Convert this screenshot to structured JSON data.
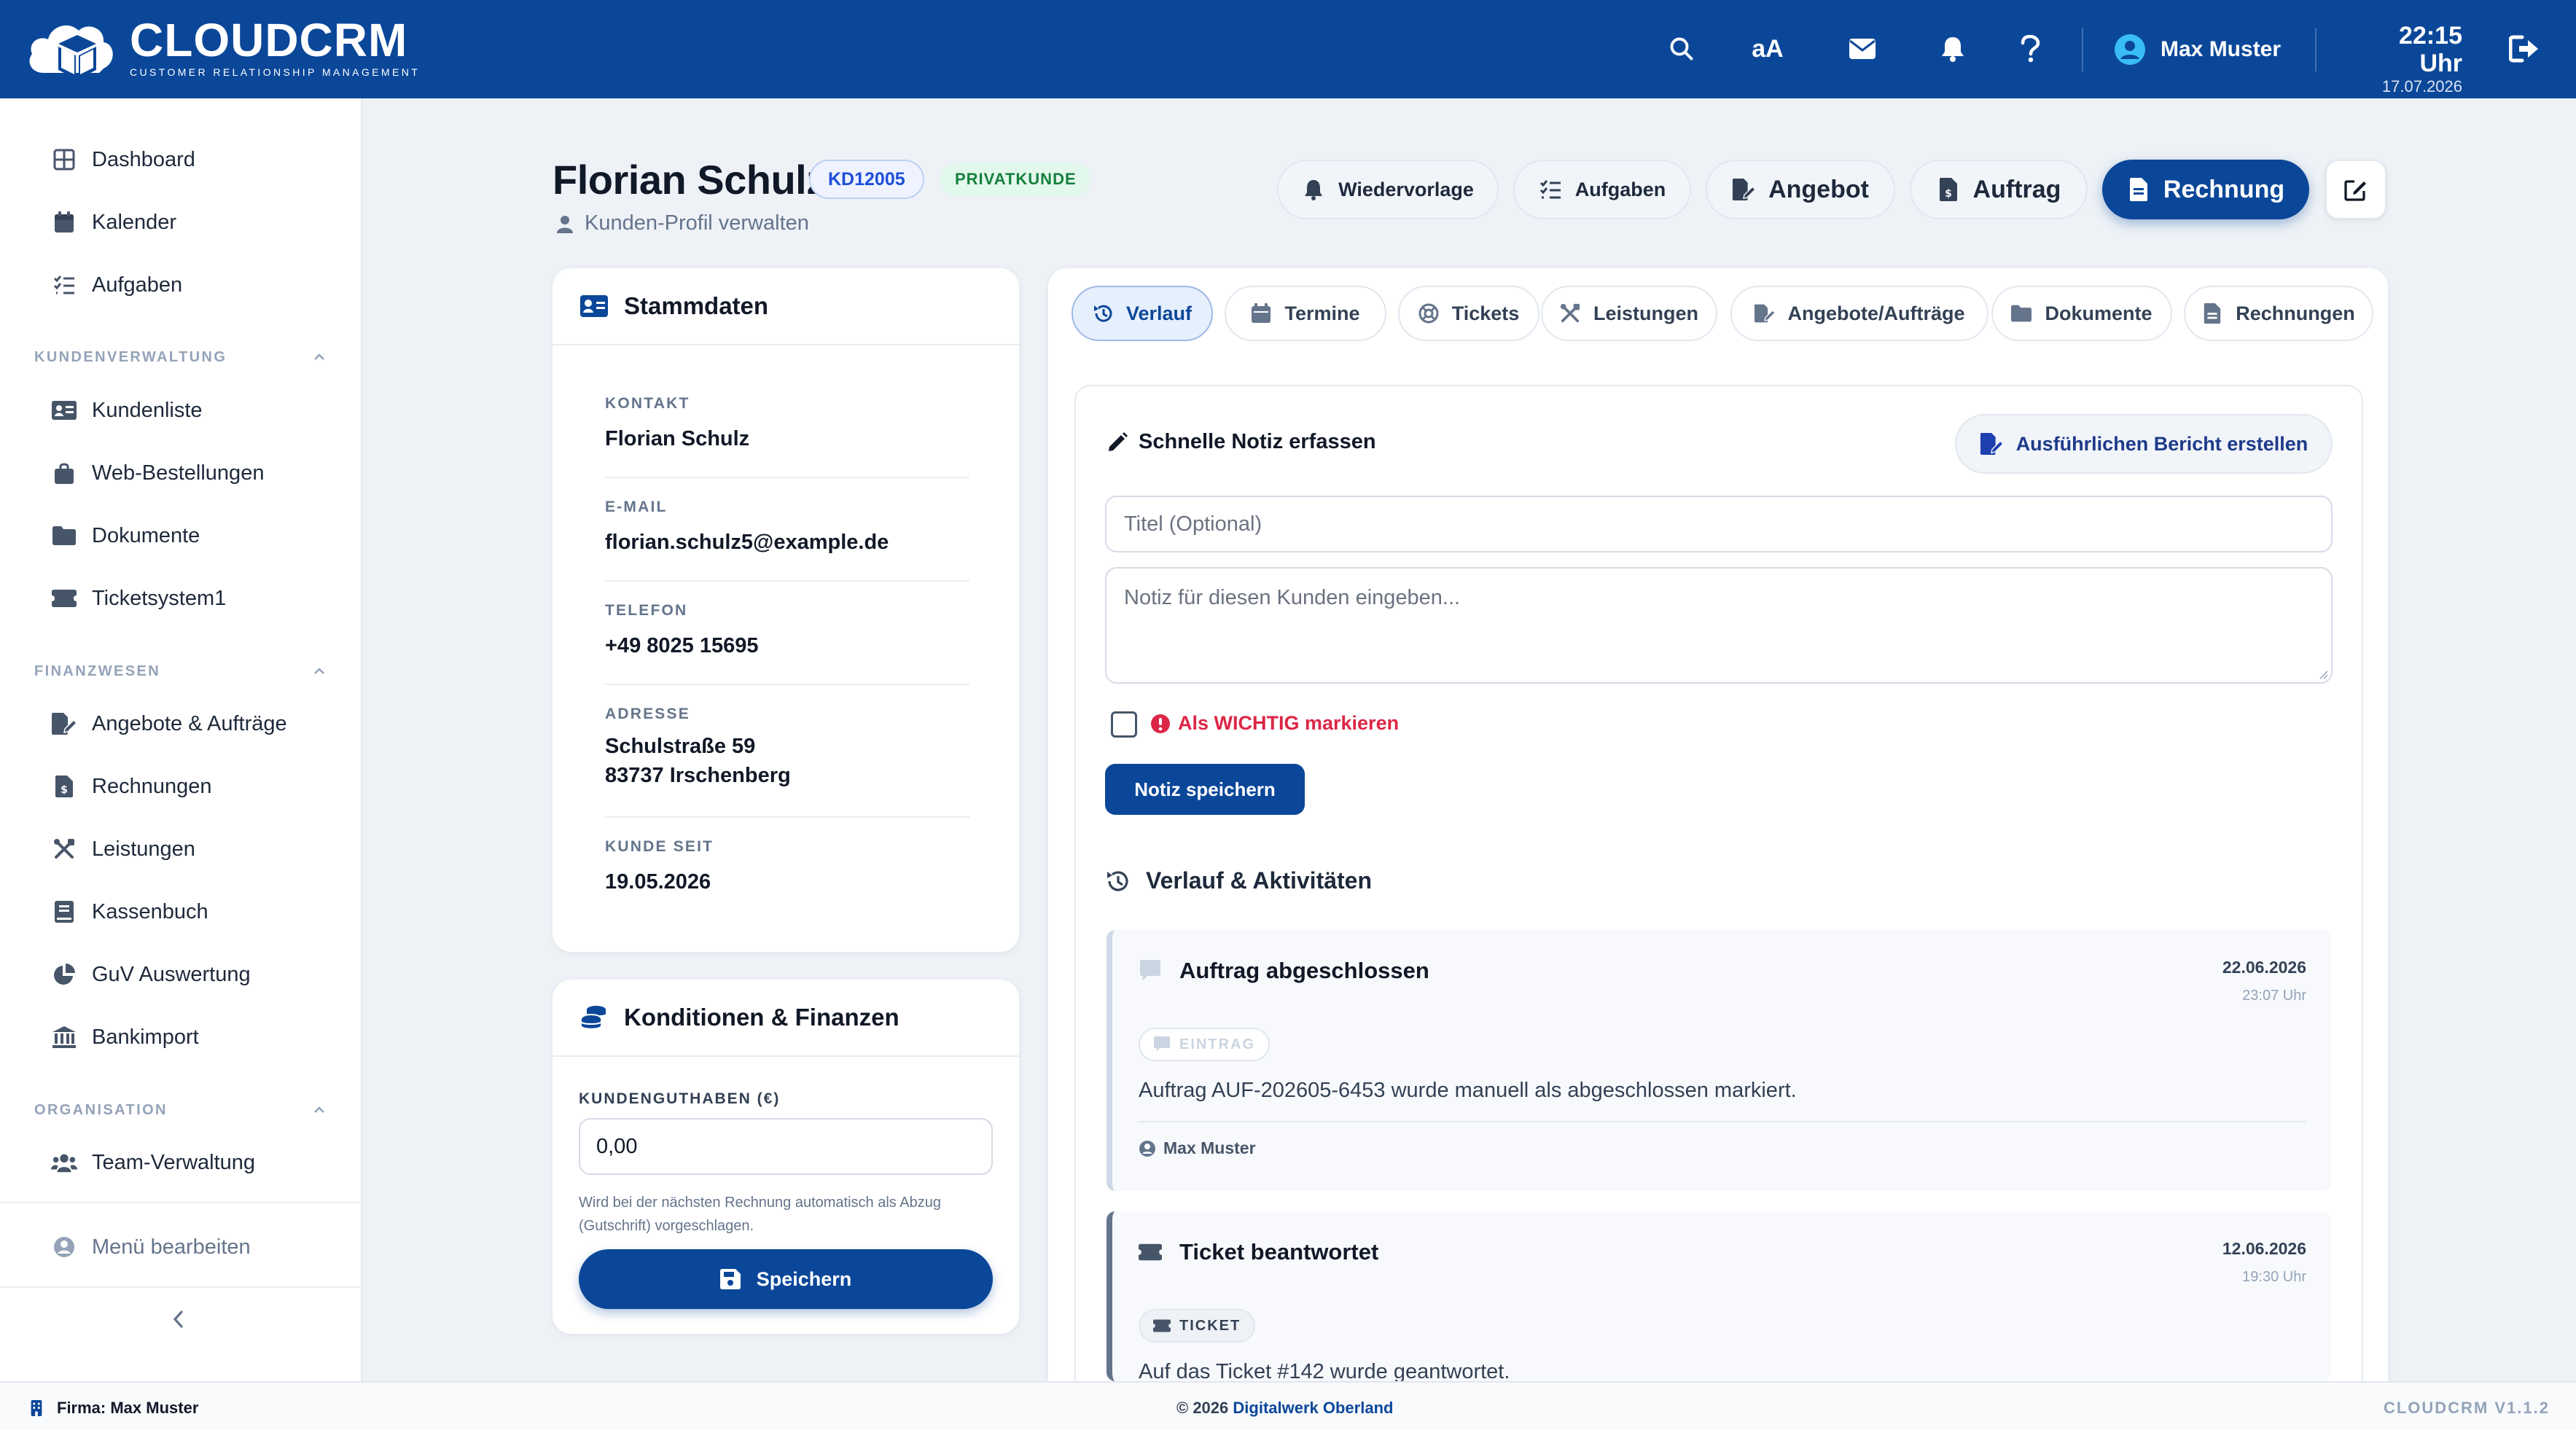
{
  "app": {
    "name": "CLOUDCRM",
    "tagline": "CUSTOMER RELATIONSHIP MANAGEMENT",
    "accent_color": "#0b4799"
  },
  "topbar": {
    "text_size_label": "aA",
    "user_name": "Max Muster",
    "time": "22:15 Uhr",
    "date": "17.07.2026"
  },
  "sidebar": {
    "items_top": [
      {
        "label": "Dashboard",
        "icon": "grid-icon"
      },
      {
        "label": "Kalender",
        "icon": "calendar-icon"
      },
      {
        "label": "Aufgaben",
        "icon": "tasks-icon"
      }
    ],
    "sections": [
      {
        "title": "KUNDENVERWALTUNG",
        "items": [
          {
            "label": "Kundenliste",
            "icon": "id-card-icon"
          },
          {
            "label": "Web-Bestellungen",
            "icon": "shopping-bag-icon"
          },
          {
            "label": "Dokumente",
            "icon": "folder-icon"
          },
          {
            "label": "Ticketsystem1",
            "icon": "ticket-icon"
          }
        ]
      },
      {
        "title": "FINANZWESEN",
        "items": [
          {
            "label": "Angebote & Aufträge",
            "icon": "file-signature-icon"
          },
          {
            "label": "Rechnungen",
            "icon": "invoice-icon"
          },
          {
            "label": "Leistungen",
            "icon": "tools-icon"
          },
          {
            "label": "Kassenbuch",
            "icon": "book-icon"
          },
          {
            "label": "GuV Auswertung",
            "icon": "pie-chart-icon"
          },
          {
            "label": "Bankimport",
            "icon": "bank-icon"
          }
        ]
      },
      {
        "title": "ORGANISATION",
        "items": [
          {
            "label": "Team-Verwaltung",
            "icon": "users-icon"
          }
        ]
      }
    ],
    "edit_menu": "Menü bearbeiten"
  },
  "customer": {
    "name": "Florian Schulz",
    "id": "KD12005",
    "type": "PRIVATKUNDE",
    "subtitle": "Kunden-Profil verwalten"
  },
  "header_buttons": {
    "wiedervorlage": "Wiedervorlage",
    "aufgaben": "Aufgaben",
    "angebot": "Angebot",
    "auftrag": "Auftrag",
    "rechnung": "Rechnung"
  },
  "stammdaten": {
    "title": "Stammdaten",
    "fields": [
      {
        "label": "KONTAKT",
        "value": "Florian Schulz"
      },
      {
        "label": "E-MAIL",
        "value": "florian.schulz5@example.de"
      },
      {
        "label": "TELEFON",
        "value": "+49 8025 15695"
      },
      {
        "label": "ADRESSE",
        "value": "Schulstraße 59",
        "value2": "83737 Irschenberg"
      },
      {
        "label": "KUNDE SEIT",
        "value": "19.05.2026"
      }
    ]
  },
  "finanzen": {
    "title": "Konditionen & Finanzen",
    "balance_label": "KUNDENGUTHABEN (€)",
    "balance_value": "0,00",
    "help_line1": "Wird bei der nächsten Rechnung automatisch als Abzug",
    "help_line2": "(Gutschrift) vorgeschlagen.",
    "save_label": "Speichern"
  },
  "tabs": [
    {
      "label": "Verlauf",
      "icon": "history-icon",
      "active": true
    },
    {
      "label": "Termine",
      "icon": "calendar-icon",
      "active": false
    },
    {
      "label": "Tickets",
      "icon": "lifebuoy-icon",
      "active": false
    },
    {
      "label": "Leistungen",
      "icon": "tools-icon",
      "active": false
    },
    {
      "label": "Angebote/Aufträge",
      "icon": "file-signature-icon",
      "active": false
    },
    {
      "label": "Dokumente",
      "icon": "folder-icon",
      "active": false
    },
    {
      "label": "Rechnungen",
      "icon": "invoice-icon",
      "active": false
    }
  ],
  "note": {
    "title": "Schnelle Notiz erfassen",
    "report_button": "Ausführlichen Bericht erstellen",
    "title_placeholder": "Titel (Optional)",
    "body_placeholder": "Notiz für diesen Kunden eingeben...",
    "important_label": "Als WICHTIG markieren",
    "important_checked": false,
    "save_label": "Notiz speichern"
  },
  "history": {
    "title": "Verlauf & Aktivitäten",
    "entries": [
      {
        "title": "Auftrag abgeschlossen",
        "date": "22.06.2026",
        "time": "23:07 Uhr",
        "badge": "EINTRAG",
        "text": "Auftrag AUF-202605-6453 wurde manuell als abgeschlossen markiert.",
        "user": "Max Muster"
      },
      {
        "title": "Ticket beantwortet",
        "date": "12.06.2026",
        "time": "19:30 Uhr",
        "badge": "TICKET",
        "text": "Auf das Ticket #142 wurde geantwortet."
      }
    ]
  },
  "footer": {
    "company": "Firma: Max Muster",
    "copyright": "© 2026",
    "copyright_link": "Digitalwerk Oberland",
    "version": "CLOUDCRM V1.1.2"
  }
}
